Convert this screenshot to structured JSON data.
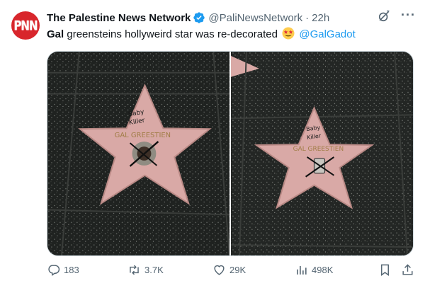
{
  "author": {
    "name": "The Palestine News Network",
    "handle": "@PaliNewsNetwork",
    "separator": "·",
    "time": "22h",
    "avatar_text": "PNN"
  },
  "tweet": {
    "bold_word": "Gal",
    "text": " greensteins hollyweird star was re-decorated",
    "emoji": "star-struck-emoji",
    "mention": "@GalGadot"
  },
  "media": {
    "photos": [
      {
        "graffiti_line1": "Baby",
        "graffiti_line2": "Killer",
        "star_name": "GAL GREESTIEN"
      },
      {
        "graffiti_line1": "Baby",
        "graffiti_line2": "Killer",
        "star_name": "GAL GREESTIEN"
      }
    ]
  },
  "actions": {
    "replies": "183",
    "reposts": "3.7K",
    "likes": "29K",
    "views": "498K"
  },
  "colors": {
    "accent": "#1d9bf0",
    "secondary_text": "#536471",
    "avatar_bg": "#d8262c",
    "star_pink": "#d9a9a6",
    "terrazzo": "#1e201f"
  }
}
